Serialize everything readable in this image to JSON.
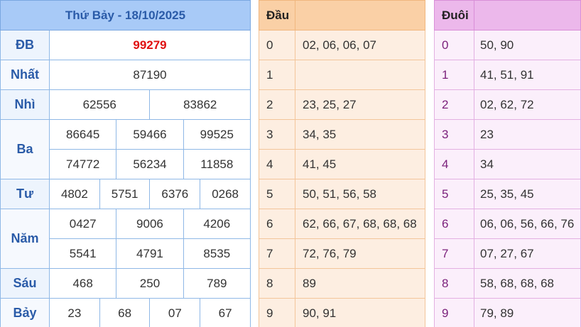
{
  "results": {
    "header": "Thứ Bảy - 18/10/2025",
    "labels": {
      "db": "ĐB",
      "nhat": "Nhất",
      "nhi": "Nhì",
      "ba": "Ba",
      "tu": "Tư",
      "nam": "Năm",
      "sau": "Sáu",
      "bay": "Bảy"
    },
    "db": [
      "99279"
    ],
    "nhat": [
      "87190"
    ],
    "nhi": [
      "62556",
      "83862"
    ],
    "ba": [
      "86645",
      "59466",
      "99525",
      "74772",
      "56234",
      "11858"
    ],
    "tu": [
      "4802",
      "5751",
      "6376",
      "0268"
    ],
    "nam": [
      "0427",
      "9006",
      "4206",
      "5541",
      "4791",
      "8535"
    ],
    "sau": [
      "468",
      "250",
      "789"
    ],
    "bay": [
      "23",
      "68",
      "07",
      "67"
    ]
  },
  "dau": {
    "header": "Đầu",
    "rows": [
      {
        "k": "0",
        "v": "02, 06, 06, 07"
      },
      {
        "k": "1",
        "v": ""
      },
      {
        "k": "2",
        "v": "23, 25, 27"
      },
      {
        "k": "3",
        "v": "34, 35"
      },
      {
        "k": "4",
        "v": "41, 45"
      },
      {
        "k": "5",
        "v": "50, 51, 56, 58"
      },
      {
        "k": "6",
        "v": "62, 66, 67, 68, 68, 68"
      },
      {
        "k": "7",
        "v": "72, 76, 79"
      },
      {
        "k": "8",
        "v": "89"
      },
      {
        "k": "9",
        "v": "90, 91"
      }
    ]
  },
  "duoi": {
    "header": "Đuôi",
    "rows": [
      {
        "k": "0",
        "v": "50, 90"
      },
      {
        "k": "1",
        "v": "41, 51, 91"
      },
      {
        "k": "2",
        "v": "02, 62, 72"
      },
      {
        "k": "3",
        "v": "23"
      },
      {
        "k": "4",
        "v": "34"
      },
      {
        "k": "5",
        "v": "25, 35, 45"
      },
      {
        "k": "6",
        "v": "06, 06, 56, 66, 76"
      },
      {
        "k": "7",
        "v": "07, 27, 67"
      },
      {
        "k": "8",
        "v": "58, 68, 68, 68"
      },
      {
        "k": "9",
        "v": "79, 89"
      }
    ]
  }
}
